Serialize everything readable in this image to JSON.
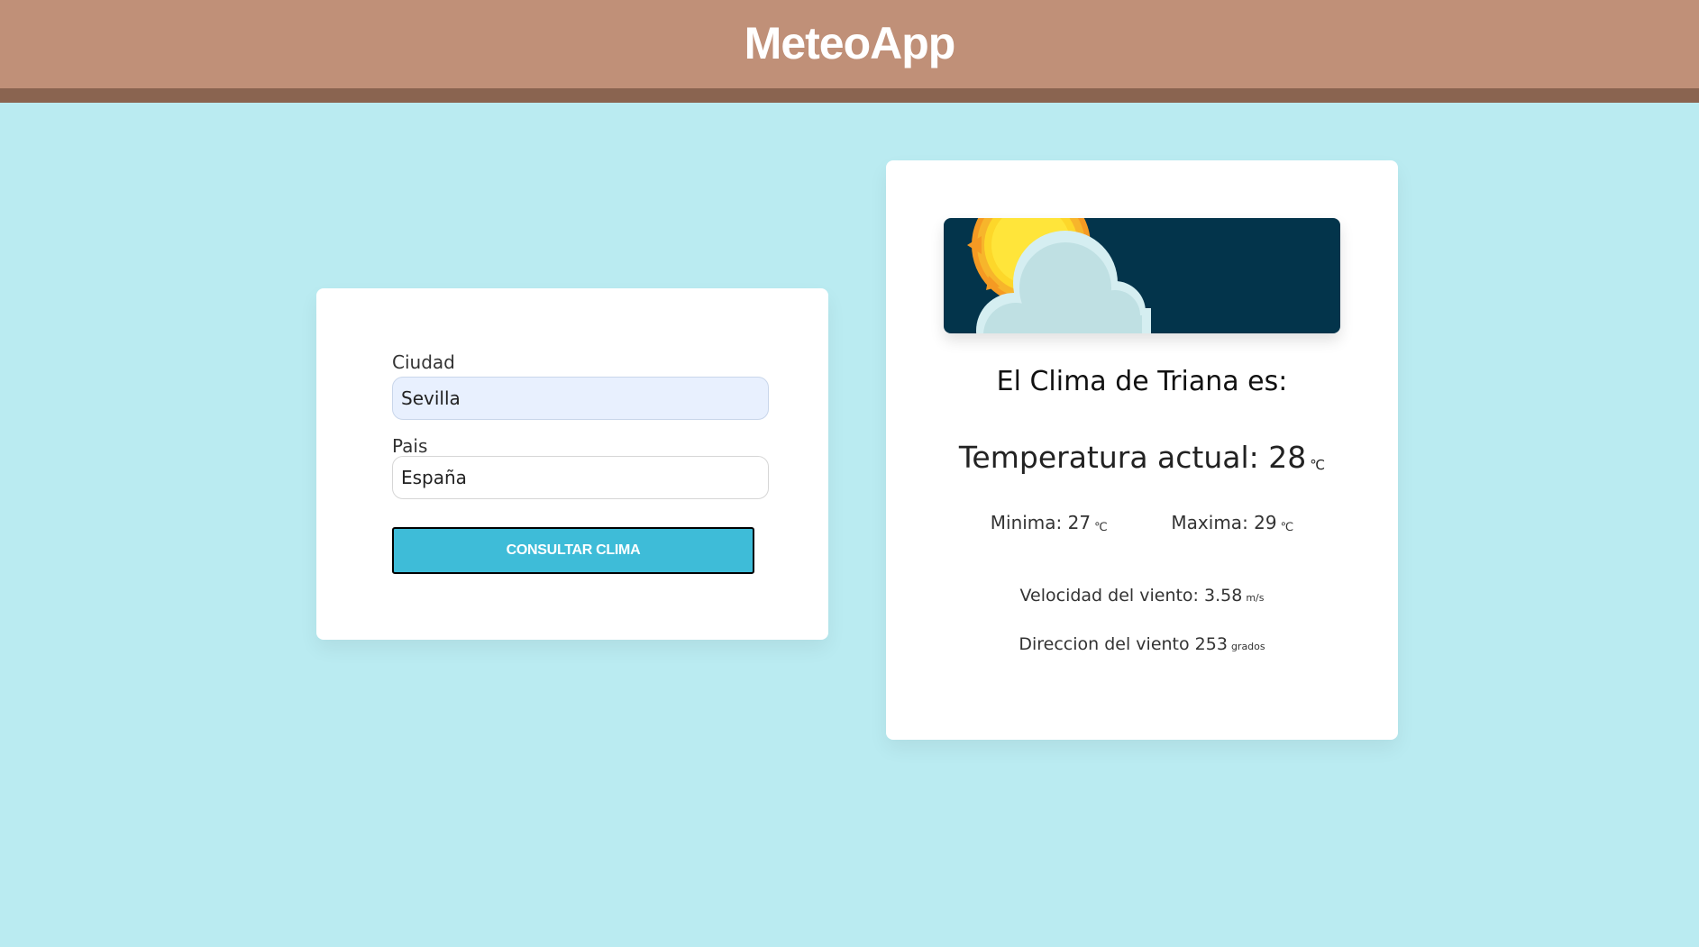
{
  "header": {
    "title": "MeteoApp"
  },
  "form": {
    "city_label": "Ciudad",
    "city_value": "Sevilla",
    "country_label": "Pais",
    "country_value": "España",
    "submit_label": "CONSULTAR CLIMA"
  },
  "result": {
    "image_icon": "sun-behind-cloud-icon",
    "heading": "El Clima de Triana es:",
    "temp_label": "Temperatura actual: ",
    "temp_value": "28",
    "temp_unit": "℃",
    "min_label": "Minima: ",
    "min_value": "27",
    "min_unit": "℃",
    "max_label": "Maxima: ",
    "max_value": "29",
    "max_unit": "℃",
    "wind_speed_label": "Velocidad del viento: ",
    "wind_speed_value": "3.58",
    "wind_speed_unit": "m/s",
    "wind_dir_label": "Direccion del viento ",
    "wind_dir_value": "253",
    "wind_dir_unit": "grados"
  },
  "colors": {
    "header_bg": "#c09078",
    "header_stripe": "#8a6450",
    "page_bg": "#baebf1",
    "button_bg": "#3ebcd8",
    "banner_bg": "#03344b"
  }
}
